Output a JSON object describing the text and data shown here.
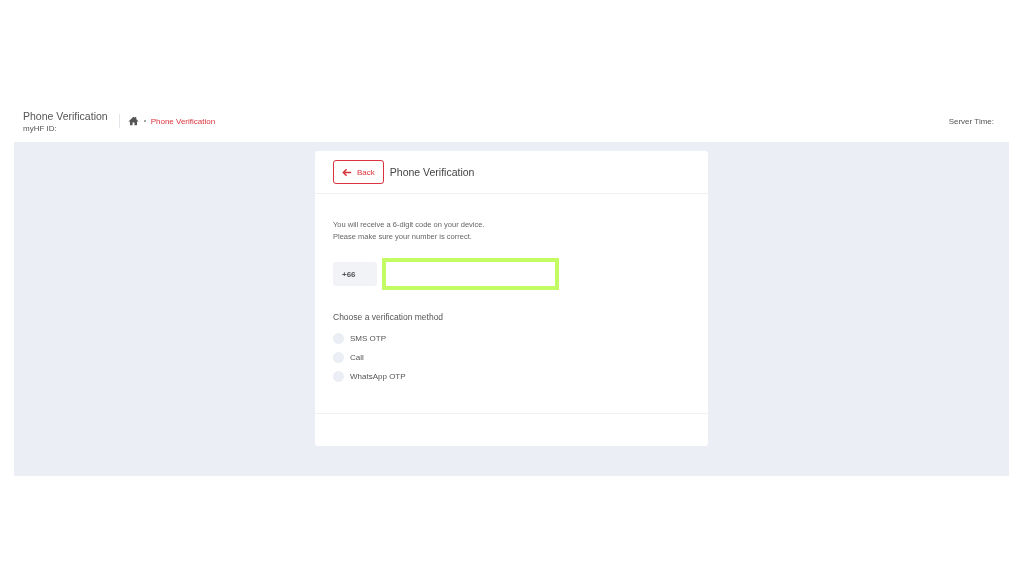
{
  "header": {
    "title": "Phone Verification",
    "subtitle": "myHF ID:",
    "breadcrumb": [
      {
        "kind": "home"
      },
      {
        "kind": "link",
        "label": "Phone Verification"
      }
    ],
    "server_time_label": "Server Time:"
  },
  "card": {
    "back_button": "Back",
    "title": "Phone Verification",
    "message": [
      "You will receive a 6-digit code on your device.",
      "Please make sure your number is correct."
    ],
    "phone": {
      "country_code": "+66",
      "highlighted": true
    },
    "method_label": "Choose a verification method",
    "methods": [
      {
        "label": "SMS OTP",
        "selected": false
      },
      {
        "label": "Call",
        "selected": false
      },
      {
        "label": "WhatsApp OTP",
        "selected": false
      }
    ]
  }
}
